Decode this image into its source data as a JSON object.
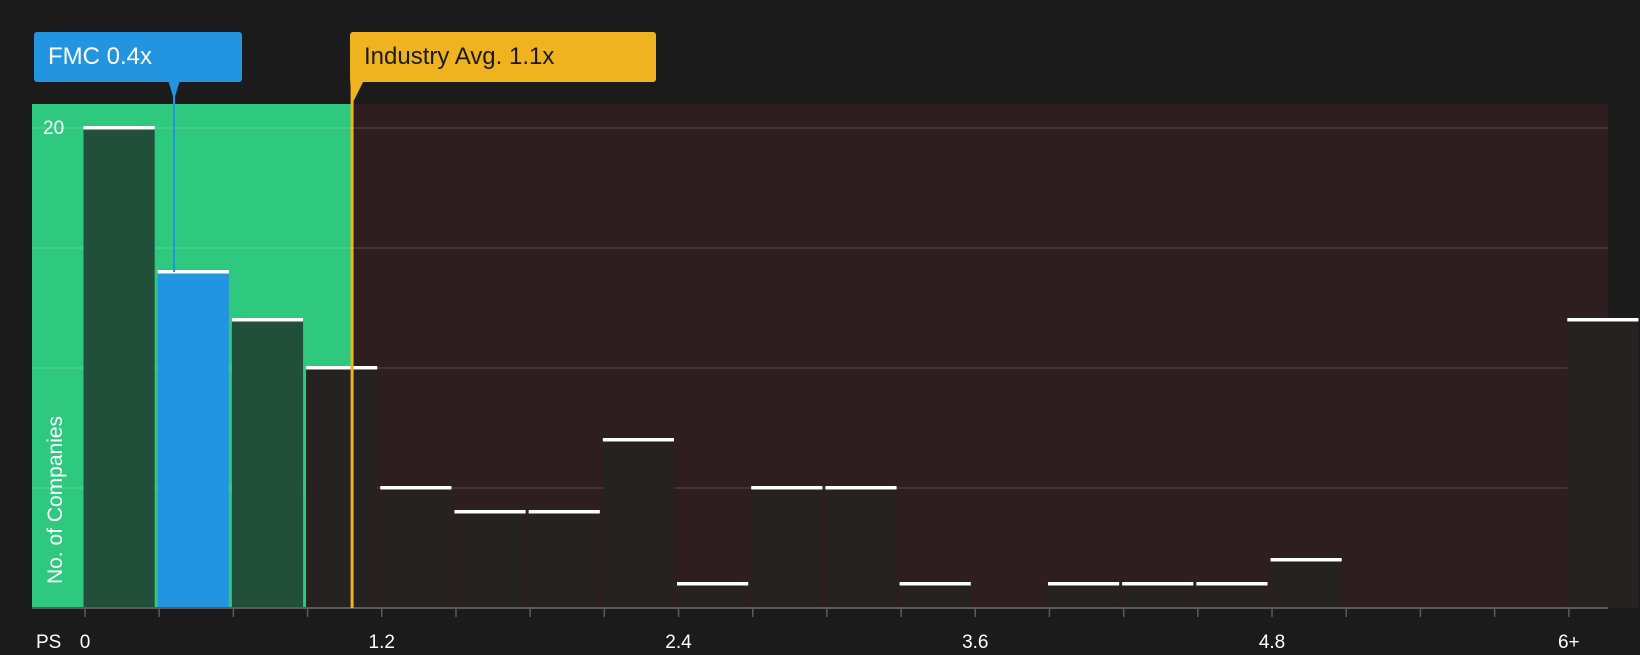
{
  "chart_data": {
    "type": "bar",
    "xlabel": "PS",
    "ylabel": "No. of Companies",
    "ylim": [
      0,
      21
    ],
    "y_ticks": [
      20
    ],
    "x_tick_labels": [
      {
        "value": 0,
        "label": "0"
      },
      {
        "value": 1.2,
        "label": "1.2"
      },
      {
        "value": 2.4,
        "label": "2.4"
      },
      {
        "value": 3.6,
        "label": "3.6"
      },
      {
        "value": 4.8,
        "label": "4.8"
      },
      {
        "value": 6,
        "label": "6+"
      }
    ],
    "bin_width": 0.3,
    "bins": [
      {
        "start": 0.0,
        "count": 20
      },
      {
        "start": 0.3,
        "count": 14,
        "highlight": true
      },
      {
        "start": 0.6,
        "count": 12
      },
      {
        "start": 0.9,
        "count": 10
      },
      {
        "start": 1.2,
        "count": 5
      },
      {
        "start": 1.5,
        "count": 4
      },
      {
        "start": 1.8,
        "count": 4
      },
      {
        "start": 2.1,
        "count": 7
      },
      {
        "start": 2.4,
        "count": 1
      },
      {
        "start": 2.7,
        "count": 5
      },
      {
        "start": 3.0,
        "count": 5
      },
      {
        "start": 3.3,
        "count": 1
      },
      {
        "start": 3.6,
        "count": 0
      },
      {
        "start": 3.9,
        "count": 1
      },
      {
        "start": 4.2,
        "count": 1
      },
      {
        "start": 4.5,
        "count": 1
      },
      {
        "start": 4.8,
        "count": 2
      },
      {
        "start": 5.1,
        "count": 0
      },
      {
        "start": 5.4,
        "count": 0
      },
      {
        "start": 5.7,
        "count": 0
      },
      {
        "start": 6.0,
        "count": 12
      }
    ],
    "company": {
      "label": "FMC 0.4x",
      "value": 0.36
    },
    "industry_avg": {
      "label": "Industry Avg. 1.1x",
      "value": 1.08
    },
    "colors": {
      "background": "#1b1b1b",
      "below_avg_zone": "#2ec97e",
      "above_avg_zone": "#2e1e1f",
      "company": "#2394e0",
      "industry": "#f0b320",
      "bar_in_zone": "#214f39",
      "bar_out_zone": "#262221",
      "bar_top": "#ffffff"
    }
  }
}
